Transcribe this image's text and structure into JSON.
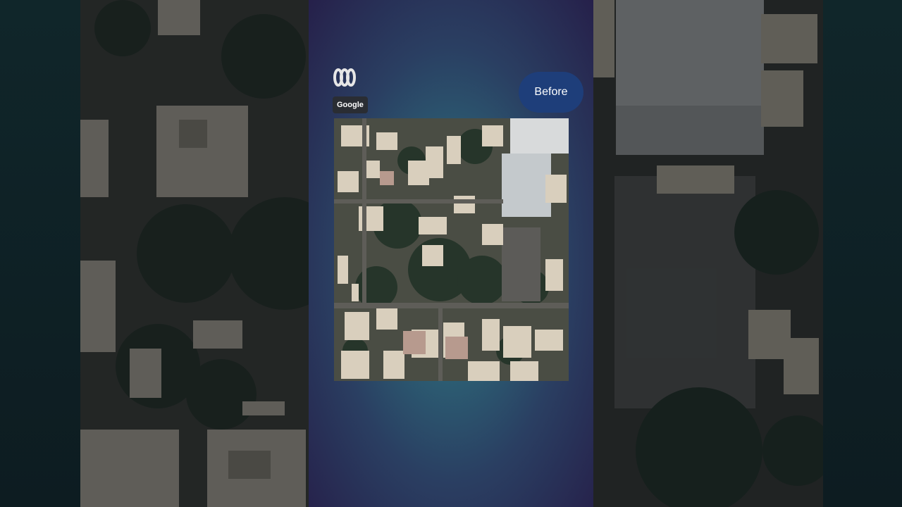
{
  "overlay": {
    "before_label": "Before"
  },
  "imagery_credit": "Google",
  "logo": {
    "name": "abc-logo"
  },
  "colors": {
    "pill_background": "#1e3e7a",
    "credit_background": "#2a2d33",
    "gradient_center": "#3e8a98",
    "gradient_edge": "#26204a"
  }
}
